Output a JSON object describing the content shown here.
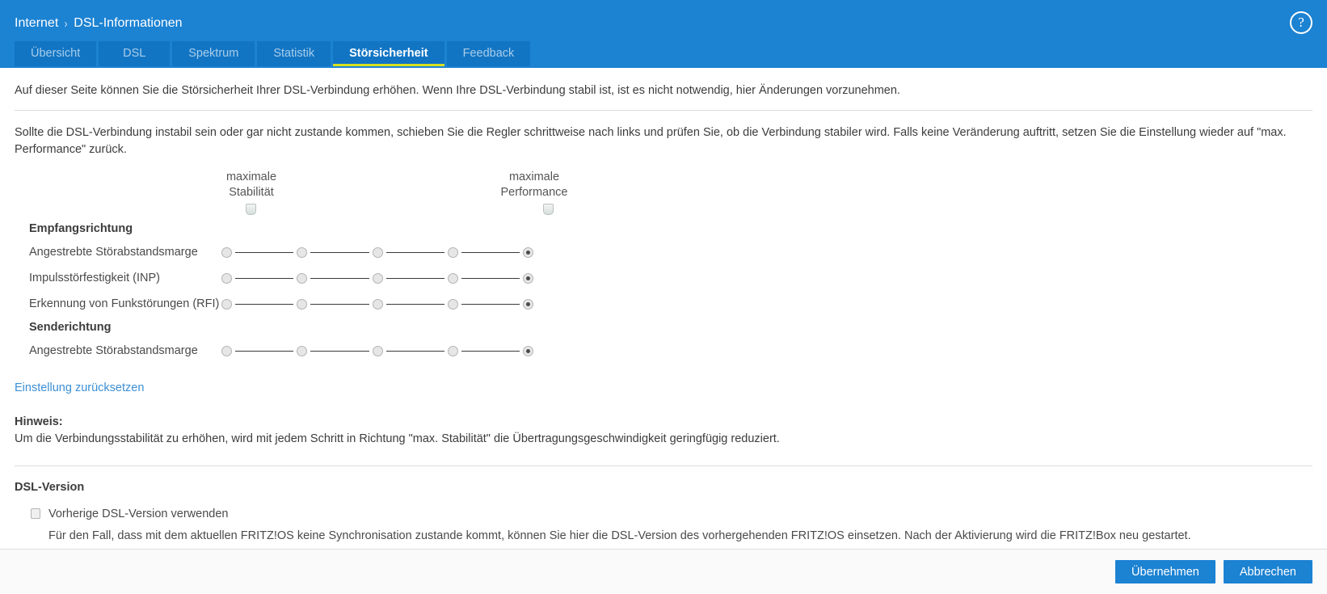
{
  "header": {
    "breadcrumb": {
      "root": "Internet",
      "separator": "›",
      "current": "DSL-Informationen"
    },
    "help_icon": "?",
    "tabs": [
      {
        "label": "Übersicht",
        "active": false
      },
      {
        "label": "DSL",
        "active": false
      },
      {
        "label": "Spektrum",
        "active": false
      },
      {
        "label": "Statistik",
        "active": false
      },
      {
        "label": "Störsicherheit",
        "active": true
      },
      {
        "label": "Feedback",
        "active": false
      }
    ],
    "accent_color": "#1c82d2",
    "active_underline_color": "#d7e021"
  },
  "content": {
    "intro": "Auf dieser Seite können Sie die Störsicherheit Ihrer DSL-Verbindung erhöhen. Wenn Ihre DSL-Verbindung stabil ist, ist es nicht notwendig, hier Änderungen vorzunehmen.",
    "instruction": "Sollte die DSL-Verbindung instabil sein oder gar nicht zustande kommen, schieben Sie die Regler schrittweise nach links und prüfen Sie, ob die Verbindung stabiler wird. Falls keine Veränderung auftritt, setzen Sie die Einstellung wieder auf \"max. Performance\" zurück.",
    "scale": {
      "left_line1": "maximale",
      "left_line2": "Stabilität",
      "right_line1": "maximale",
      "right_line2": "Performance"
    },
    "groups": [
      {
        "title": "Empfangsrichtung",
        "rows": [
          {
            "label": "Angestrebte Störabstandsmarge",
            "steps": 5,
            "selected": 5
          },
          {
            "label": "Impulsstörfestigkeit (INP)",
            "steps": 5,
            "selected": 5
          },
          {
            "label": "Erkennung von Funkstörungen (RFI)",
            "steps": 5,
            "selected": 5
          }
        ]
      },
      {
        "title": "Senderichtung",
        "rows": [
          {
            "label": "Angestrebte Störabstandsmarge",
            "steps": 5,
            "selected": 5
          }
        ]
      }
    ],
    "reset_link": "Einstellung zurücksetzen",
    "note_title": "Hinweis:",
    "note_body": "Um die Verbindungsstabilität zu erhöhen, wird mit jedem Schritt in Richtung \"max. Stabilität\" die Übertragungsgeschwindigkeit geringfügig reduziert.",
    "dsl_version": {
      "title": "DSL-Version",
      "checkbox_label": "Vorherige DSL-Version verwenden",
      "checkbox_checked": false,
      "description": "Für den Fall, dass mit dem aktuellen FRITZ!OS keine Synchronisation zustande kommt, können Sie hier die DSL-Version des vorhergehenden FRITZ!OS einsetzen. Nach der Aktivierung wird die FRITZ!Box neu gestartet."
    }
  },
  "footer": {
    "apply_label": "Übernehmen",
    "cancel_label": "Abbrechen"
  }
}
